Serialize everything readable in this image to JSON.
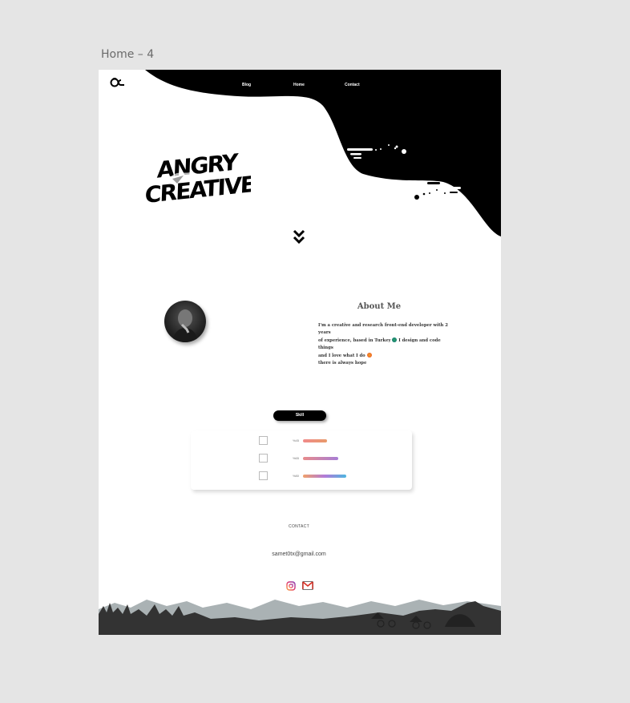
{
  "artboard": {
    "title": "Home – 4"
  },
  "nav": {
    "blog": "Blog",
    "home": "Home",
    "contact": "Contact"
  },
  "hero": {
    "line1": "ANGRY",
    "line2": "CREATIVE"
  },
  "about": {
    "title": "About Me",
    "line1": "I'm a creative and research front-end developer with 2 years",
    "line2a": "of experience, based in Turkey",
    "line2b": "I design and code things",
    "line3": "and I love what I do",
    "line4": "there is always hope"
  },
  "skill": {
    "label": "Skill",
    "items": [
      {
        "percent": "%45",
        "level": 0.45,
        "gradient": "linear-gradient(90deg,#f08a8a,#e89a6a)"
      },
      {
        "percent": "%65",
        "level": 0.65,
        "gradient": "linear-gradient(90deg,#e88b8b,#a77dd6)"
      },
      {
        "percent": "%80",
        "level": 0.8,
        "gradient": "linear-gradient(90deg,#f0a06a,#b27ad8,#4db6e0)"
      }
    ]
  },
  "contact": {
    "label": "CONTACT",
    "email": "samet0tx@gmail.com"
  },
  "icons": {
    "logo": "brand-logo-icon",
    "scroll": "double-chevron-down-icon",
    "instagram": "instagram-icon",
    "gmail": "gmail-icon"
  },
  "colors": {
    "canvas": "#e5e5e5",
    "page": "#ffffff",
    "ink": "#000000",
    "footer": "#333333",
    "mountains": "#aab2b4"
  }
}
